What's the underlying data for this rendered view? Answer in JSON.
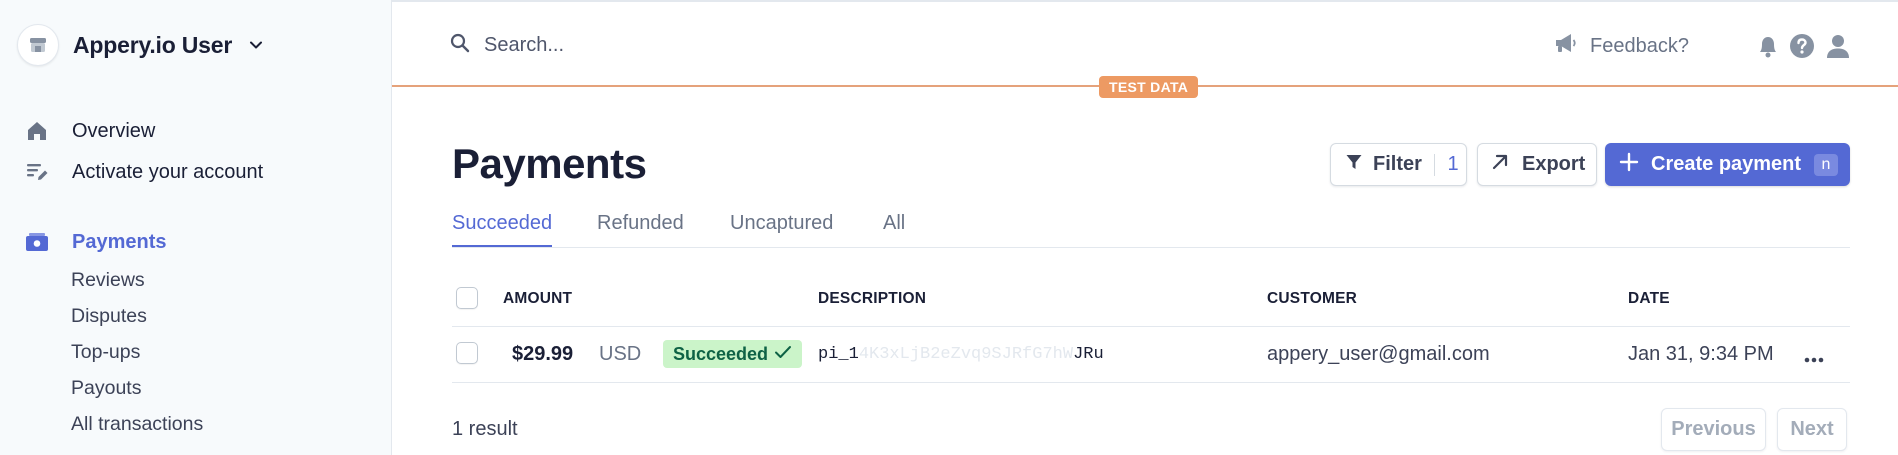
{
  "account": {
    "name": "Appery.io User"
  },
  "sidebar": {
    "primary": [
      {
        "label": "Overview",
        "icon": "home-icon"
      },
      {
        "label": "Activate your account",
        "icon": "checklist-edit-icon"
      }
    ],
    "section": {
      "label": "Payments",
      "icon": "payments-icon"
    },
    "sub_items": [
      "Reviews",
      "Disputes",
      "Top-ups",
      "Payouts",
      "All transactions"
    ]
  },
  "header": {
    "search_placeholder": "Search...",
    "feedback_label": "Feedback?",
    "icons": [
      "bell-icon",
      "help-icon",
      "user-icon"
    ]
  },
  "test_badge": "TEST DATA",
  "page": {
    "title": "Payments",
    "filter_label": "Filter",
    "filter_count": "1",
    "export_label": "Export",
    "create_label": "Create payment",
    "create_shortcut": "n"
  },
  "tabs": [
    "Succeeded",
    "Refunded",
    "Uncaptured",
    "All"
  ],
  "active_tab": "Succeeded",
  "table": {
    "columns": {
      "amount": "AMOUNT",
      "description": "DESCRIPTION",
      "customer": "CUSTOMER",
      "date": "DATE"
    },
    "rows": [
      {
        "amount": "$29.99",
        "currency": "USD",
        "status": "Succeeded",
        "description_start": "pi_1",
        "description_hidden": "4K3xLjB2eZvq9SJRfG7hW",
        "description_end": "JRu",
        "customer": "appery_user@gmail.com",
        "date": "Jan 31, 9:34 PM"
      }
    ]
  },
  "footer": {
    "result_text": "1 result",
    "previous": "Previous",
    "next": "Next"
  },
  "colors": {
    "accent": "#5469d4",
    "test_badge": "#ed9a63",
    "success_bg": "#cbf4c9",
    "success_text": "#0e6245"
  }
}
